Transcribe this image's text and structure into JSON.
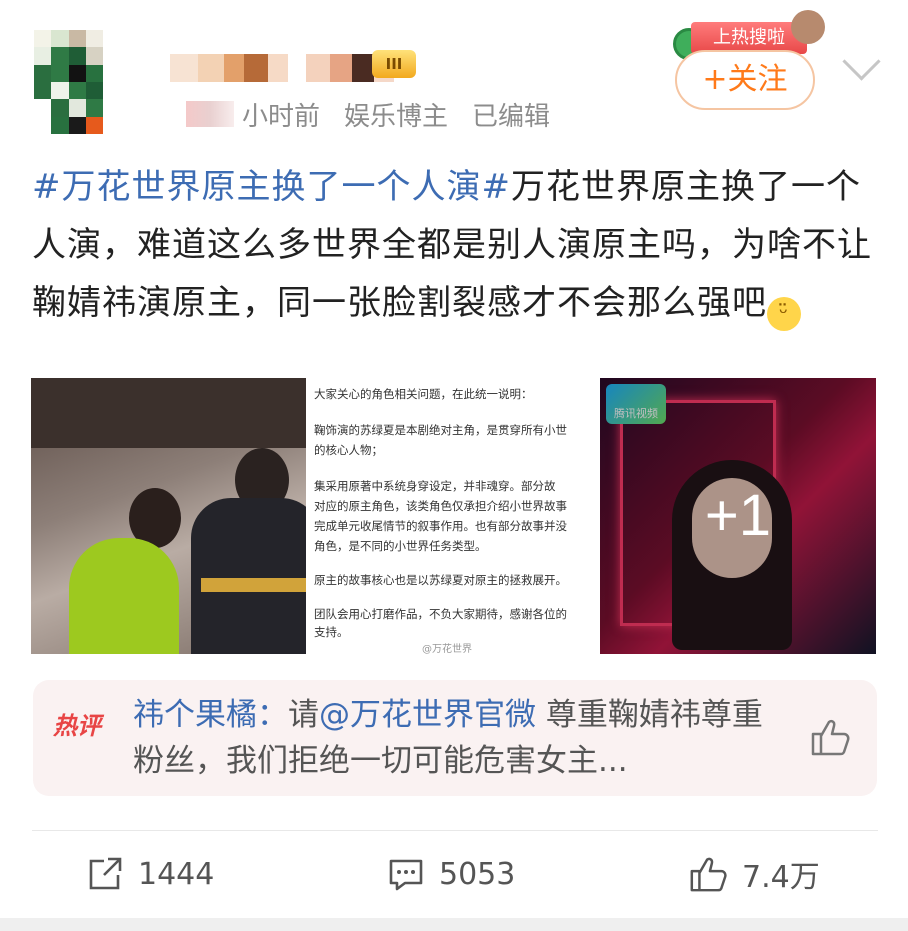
{
  "header": {
    "vip_label": "III",
    "time": "小时前",
    "role": "娱乐博主",
    "edited": "已编辑",
    "hot_tag": "上热搜啦",
    "follow_label": "+关注"
  },
  "post": {
    "hashtag": "#万花世界原主换了一个人演#",
    "body": "万花世界原主换了一个人演，难道这么多世界全都是别人演原主吗，为啥不让鞠婧祎演原主，同一张脸割裂感才不会那么强吧"
  },
  "images": {
    "notice_lines": [
      "大家关心的角色相关问题，在此统一说明：",
      "",
      "鞠饰演的苏绿夏是本剧绝对主角，是贯穿所有小世",
      "的核心人物；",
      "",
      "集采用原著中系统身穿设定，并非魂穿。部分故",
      "对应的原主角色，该类角色仅承担介绍小世界故事",
      "完成单元收尾情节的叙事作用。也有部分故事并没",
      "角色，是不同的小世界任务类型。",
      "",
      "原主的故事核心也是以苏绿夏对原主的拯救展开。",
      "",
      "团队会用心打磨作品，不负大家期待，感谢各位的",
      "支持。"
    ],
    "watermark": "@万花世界",
    "tencent_label": "腾讯视频",
    "more_count": "+1"
  },
  "hot_comment": {
    "label": "热评",
    "user": "祎个果橘：",
    "prefix": "请",
    "mention": "@万花世界官微",
    "text": " 尊重鞠婧祎尊重粉丝，我们拒绝一切可能危害女主..."
  },
  "actions": {
    "repost_count": "1444",
    "comment_count": "5053",
    "like_count": "7.4万"
  },
  "colors": {
    "link": "#3d6cb3",
    "follow": "#ff7a1a",
    "hot_label": "#e84545"
  }
}
